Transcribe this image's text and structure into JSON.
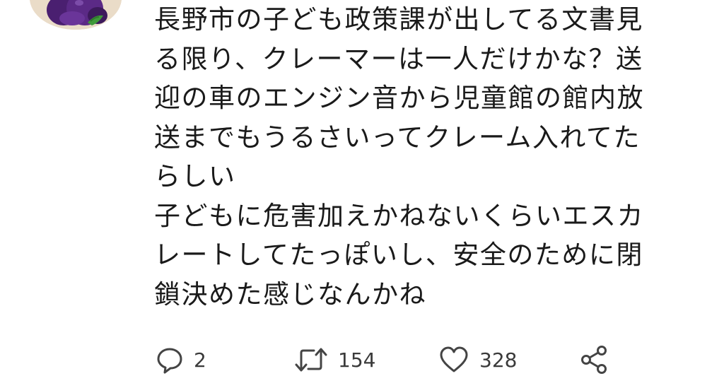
{
  "tweet": {
    "text_lines": [
      "長野市の子ども政策課が出してる文書見",
      "る限り、クレーマーは一人だけかな？送",
      "迎の車のエンジン音から児童館の館内放",
      "送までもうるさいってクレーム入れてた",
      "らしい",
      "子どもに危害加えかねないくらいエスカ",
      "レートしてたっぽいし、安全のために閉",
      "鎖決めた感じなんかね"
    ]
  },
  "actions": {
    "reply_count": "2",
    "retweet_count": "154",
    "like_count": "328"
  },
  "icons": {
    "reply": "speech-bubble-icon",
    "retweet": "retweet-arrows-icon",
    "like": "heart-outline-icon",
    "share": "share-nodes-icon"
  },
  "colors": {
    "icon_gray": "#536471",
    "text": "#1a1a1a",
    "avatar_purple": "#5b2a86"
  }
}
